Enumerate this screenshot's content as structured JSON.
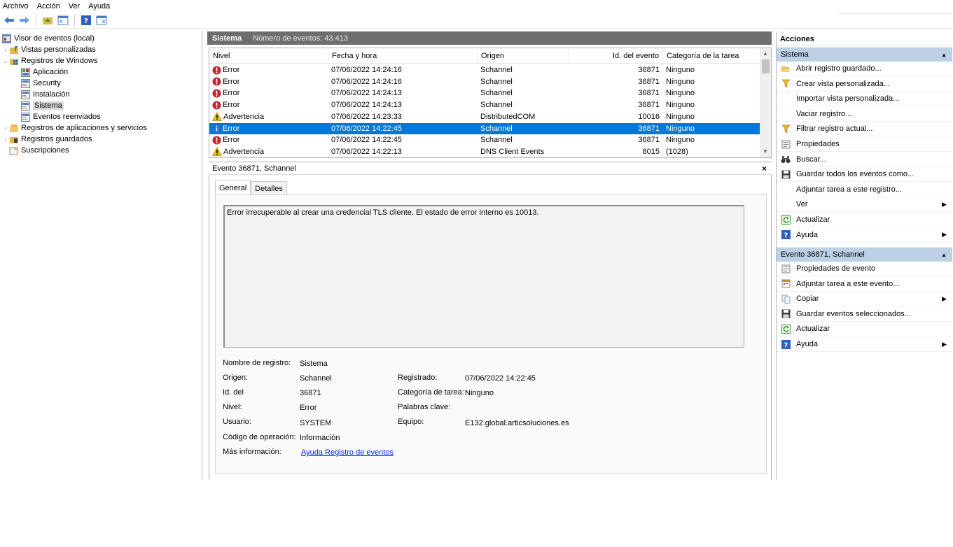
{
  "menu": [
    "Archivo",
    "Acción",
    "Ver",
    "Ayuda"
  ],
  "tree": {
    "root": "Visor de eventos (local)",
    "items": [
      {
        "label": "Vistas personalizadas",
        "level": 1,
        "expander": "›"
      },
      {
        "label": "Registros de Windows",
        "level": 1,
        "expander": "⌄"
      },
      {
        "label": "Aplicación",
        "level": 2,
        "expander": ""
      },
      {
        "label": "Security",
        "level": 2,
        "expander": ""
      },
      {
        "label": "Instalación",
        "level": 2,
        "expander": ""
      },
      {
        "label": "Sistema",
        "level": 2,
        "expander": ""
      },
      {
        "label": "Eventos reenviados",
        "level": 2,
        "expander": ""
      },
      {
        "label": "Registros de aplicaciones y servicios",
        "level": 1,
        "expander": "›"
      },
      {
        "label": "Registros guardados",
        "level": 1,
        "expander": "›"
      },
      {
        "label": "Suscripciones",
        "level": 1,
        "expander": ""
      }
    ]
  },
  "center": {
    "log_name": "Sistema",
    "event_count": "Número de eventos: 43.413"
  },
  "table": {
    "headers": [
      "Nivel",
      "Fecha y hora",
      "Origen",
      "Id. del evento",
      "Categoría de la tarea"
    ],
    "rows": [
      {
        "level": "Error",
        "date": "07/06/2022 14:24:16",
        "source": "Schannel",
        "id": "36871",
        "cat": "Ninguno"
      },
      {
        "level": "Error",
        "date": "07/06/2022 14:24:16",
        "source": "Schannel",
        "id": "36871",
        "cat": "Ninguno"
      },
      {
        "level": "Error",
        "date": "07/06/2022 14:24:13",
        "source": "Schannel",
        "id": "36871",
        "cat": "Ninguno"
      },
      {
        "level": "Error",
        "date": "07/06/2022 14:24:13",
        "source": "Schannel",
        "id": "36871",
        "cat": "Ninguno"
      },
      {
        "level": "Advertencia",
        "date": "07/06/2022 14:23:33",
        "source": "DistributedCOM",
        "id": "10016",
        "cat": "Ninguno"
      },
      {
        "level": "Error",
        "date": "07/06/2022 14:22:45",
        "source": "Schannel",
        "id": "36871",
        "cat": "Ninguno"
      },
      {
        "level": "Error",
        "date": "07/06/2022 14:22:45",
        "source": "Schannel",
        "id": "36871",
        "cat": "Ninguno"
      },
      {
        "level": "Advertencia",
        "date": "07/06/2022 14:22:13",
        "source": "DNS Client Events",
        "id": "8015",
        "cat": "(1028)"
      }
    ]
  },
  "detail": {
    "title": "Evento 36871, Schannel",
    "close": "×",
    "tabs": [
      "General",
      "Detalles"
    ],
    "message": "Error irrecuperable al crear una credencial TLS cliente. El estado de error interno es 10013.",
    "labels": {
      "log_name": "Nombre de registro:",
      "source": "Origen:",
      "event_id": "Id. del",
      "level": "Nivel:",
      "user": "Usuario:",
      "opcode": "Código de operación:",
      "more": "Más información:",
      "logged": "Registrado:",
      "task_cat": "Categoría de tarea:",
      "keywords": "Palabras clave:",
      "computer": "Equipo:"
    },
    "values": {
      "log_name": "Sistema",
      "source": "Schannel",
      "event_id": "36871",
      "level": "Error",
      "user": "SYSTEM",
      "opcode": "Información",
      "more": "Ayuda Registro de eventos",
      "logged": "07/06/2022 14:22:45",
      "task_cat": "Ninguno",
      "keywords": "",
      "computer": "E132.global.articsoluciones.es"
    }
  },
  "actions": {
    "title": "Acciones",
    "section1": "Sistema",
    "section1_items": [
      {
        "label": "Abrir registro guardado...",
        "icon": "open-folder-icon",
        "arrow": false
      },
      {
        "label": "Crear vista personalizada...",
        "icon": "filter-icon",
        "arrow": false
      },
      {
        "label": "Importar vista personalizada...",
        "icon": "",
        "arrow": false
      },
      {
        "label": "Vaciar registro...",
        "icon": "",
        "arrow": false
      },
      {
        "label": "Filtrar registro actual...",
        "icon": "filter-icon",
        "arrow": false
      },
      {
        "label": "Propiedades",
        "icon": "properties-icon",
        "arrow": false
      },
      {
        "label": "Buscar...",
        "icon": "binoculars-icon",
        "arrow": false
      },
      {
        "label": "Guardar todos los eventos como...",
        "icon": "save-icon",
        "arrow": false
      },
      {
        "label": "Adjuntar tarea a este registro...",
        "icon": "",
        "arrow": false
      },
      {
        "label": "Ver",
        "icon": "",
        "arrow": true
      },
      {
        "label": "Actualizar",
        "icon": "refresh-icon",
        "arrow": false
      },
      {
        "label": "Ayuda",
        "icon": "help-icon",
        "arrow": true
      }
    ],
    "section2": "Evento 36871, Schannel",
    "section2_items": [
      {
        "label": "Propiedades de evento",
        "icon": "properties-icon",
        "arrow": false
      },
      {
        "label": "Adjuntar tarea a este evento...",
        "icon": "task-icon",
        "arrow": false
      },
      {
        "label": "Copiar",
        "icon": "copy-icon",
        "arrow": true
      },
      {
        "label": "Guardar eventos seleccionados...",
        "icon": "save-icon",
        "arrow": false
      },
      {
        "label": "Actualizar",
        "icon": "refresh-icon",
        "arrow": false
      },
      {
        "label": "Ayuda",
        "icon": "help-icon",
        "arrow": true
      }
    ]
  },
  "colors": {
    "selection": "#0078d7",
    "section_header": "#bcd0e6",
    "header_bar": "#6e6e6e",
    "error_red": "#c4262e",
    "warning_yellow": "#f2c200"
  }
}
